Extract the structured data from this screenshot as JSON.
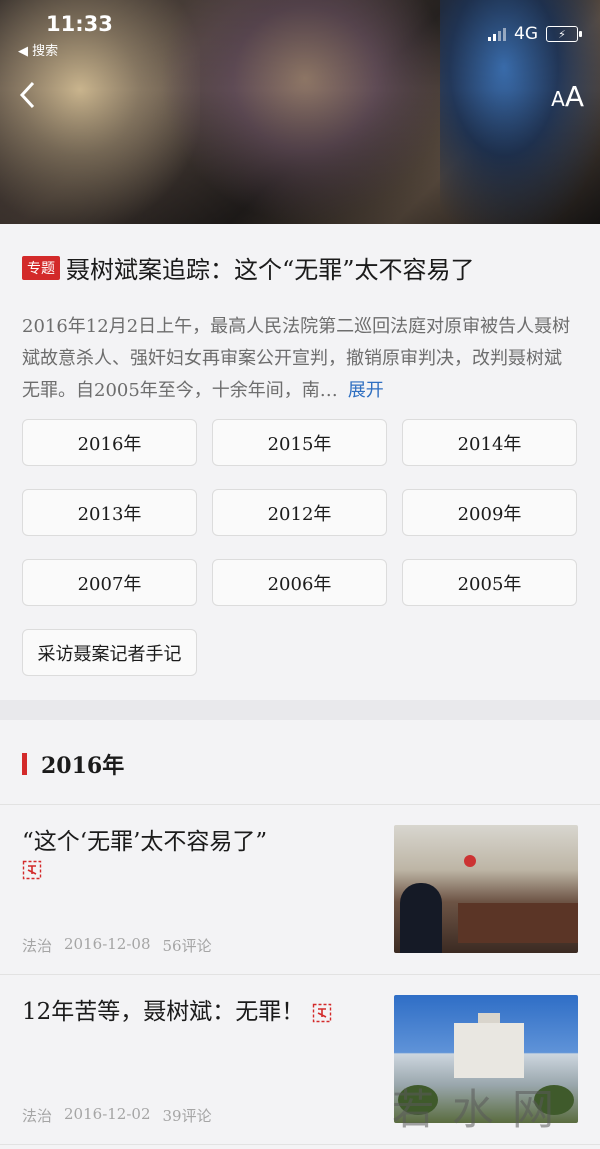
{
  "status_bar": {
    "time": "11:33",
    "back_app": "◀ 搜索",
    "network": "4G",
    "battery_symbol": "⚡"
  },
  "nav": {
    "back_icon": "chevron-left-icon",
    "font_size_small": "A",
    "font_size_large": "A"
  },
  "topic": {
    "badge": "专题",
    "title": "聂树斌案追踪：这个“无罪”太不容易了",
    "summary": "2016年12月2日上午，最高人民法院第二巡回法庭对原审被告人聂树斌故意杀人、强奸妇女再审案公开宣判，撤销原审判决，改判聂树斌无罪。自2005年至今，十余年间，南…",
    "expand_label": "展开",
    "years": [
      "2016年",
      "2015年",
      "2014年",
      "2013年",
      "2012年",
      "2009年",
      "2007年",
      "2006年",
      "2005年"
    ],
    "notes_label": "采访聂案记者手记"
  },
  "section": {
    "title": "2016年"
  },
  "articles": [
    {
      "title": "“这个‘无罪’太不容易了”",
      "category": "法治",
      "date": "2016-12-08",
      "comments": "56评论"
    },
    {
      "title": "12年苦等，聂树斌：无罪！",
      "category": "法治",
      "date": "2016-12-02",
      "comments": "39评论"
    }
  ],
  "watermark": "若水网",
  "colors": {
    "accent_red": "#d32a2a",
    "link_blue": "#2f6fc1",
    "meta_gray": "#a5a5a5"
  }
}
